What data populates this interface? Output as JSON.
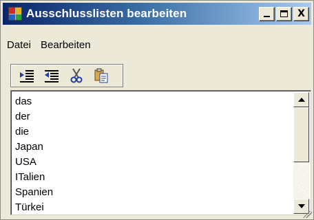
{
  "window": {
    "title": "Ausschlusslisten bearbeiten",
    "controls": {
      "minimize": "_",
      "maximize": "□",
      "close": "X"
    }
  },
  "menu": {
    "items": [
      "Datei",
      "Bearbeiten"
    ]
  },
  "toolbar": {
    "buttons": [
      {
        "icon": "indent-left-icon"
      },
      {
        "icon": "indent-right-icon"
      },
      {
        "icon": "cut-icon"
      },
      {
        "icon": "paste-icon"
      }
    ]
  },
  "list": {
    "items": [
      "das",
      "der",
      "die",
      "Japan",
      "USA",
      "ITalien",
      "Spanien",
      "Türkei"
    ]
  },
  "colors": {
    "titlebar_start": "#0a246a",
    "titlebar_end": "#a6caf0",
    "window_bg": "#ece9d8"
  }
}
